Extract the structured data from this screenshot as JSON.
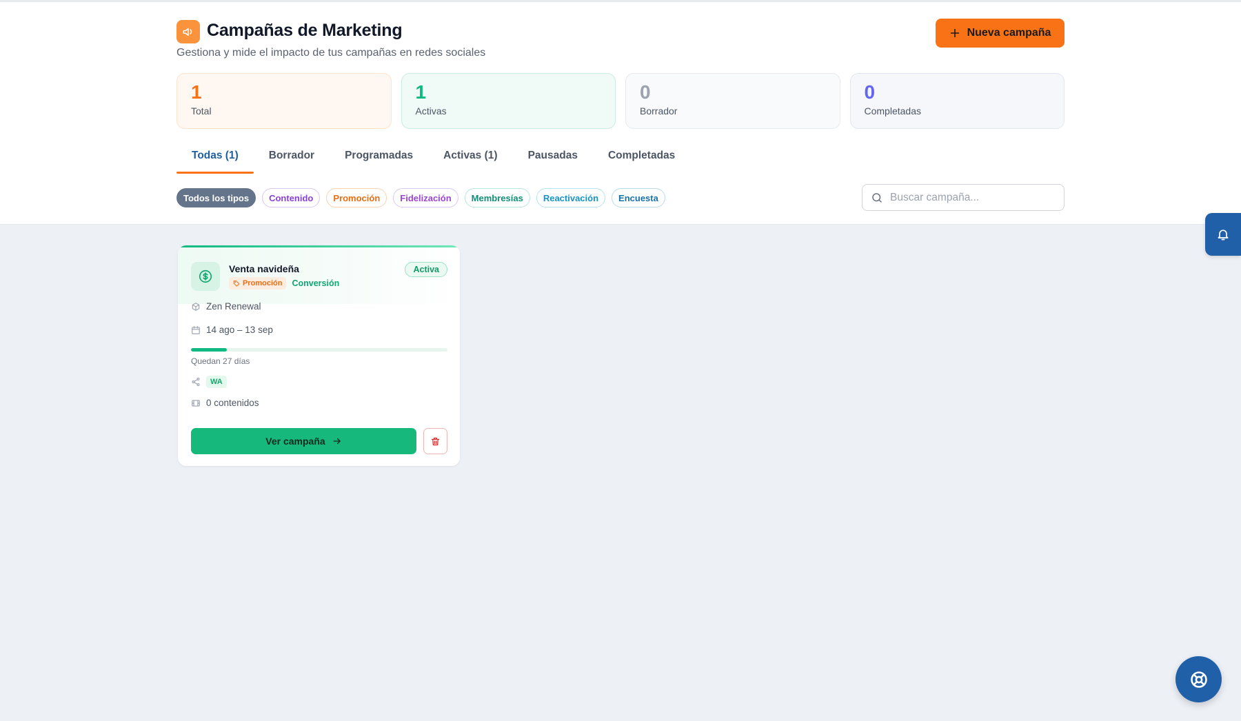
{
  "header": {
    "title": "Campañas de Marketing",
    "subtitle": "Gestiona y mide el impacto de tus campañas en redes sociales",
    "new_button_label": "Nueva campaña",
    "logo_icon": "megaphone-icon"
  },
  "stats": [
    {
      "value": "1",
      "label": "Total",
      "color": "#f97316"
    },
    {
      "value": "1",
      "label": "Activas",
      "color": "#10b981"
    },
    {
      "value": "0",
      "label": "Borrador",
      "color": "#9ca3af"
    },
    {
      "value": "0",
      "label": "Completadas",
      "color": "#6366f1"
    }
  ],
  "tabs": [
    {
      "label": "Todas (1)",
      "active": true
    },
    {
      "label": "Borrador"
    },
    {
      "label": "Programadas"
    },
    {
      "label": "Activas (1)"
    },
    {
      "label": "Pausadas"
    },
    {
      "label": "Completadas"
    }
  ],
  "type_filters": [
    {
      "label": "Todos los tipos",
      "selected": true
    },
    {
      "label": "Contenido"
    },
    {
      "label": "Promoción"
    },
    {
      "label": "Fidelización"
    },
    {
      "label": "Membresías"
    },
    {
      "label": "Reactivación"
    },
    {
      "label": "Encuesta"
    }
  ],
  "search": {
    "placeholder": "Buscar campaña..."
  },
  "campaigns": [
    {
      "title": "Venta navideña",
      "type_tag": "Promoción",
      "goal": "Conversión",
      "status": "Activa",
      "brand": "Zen Renewal",
      "date_range": "14 ago – 13 sep",
      "progress": 0.14,
      "days_left": "Quedan 27 días",
      "channel": "WA",
      "content_count": "0 contenidos",
      "view_label": "Ver campaña",
      "accent_color": "#10b981"
    }
  ],
  "colors": {
    "brand_orange": "#f97316",
    "success_green": "#10b981",
    "nav_blue": "#2060a8"
  }
}
